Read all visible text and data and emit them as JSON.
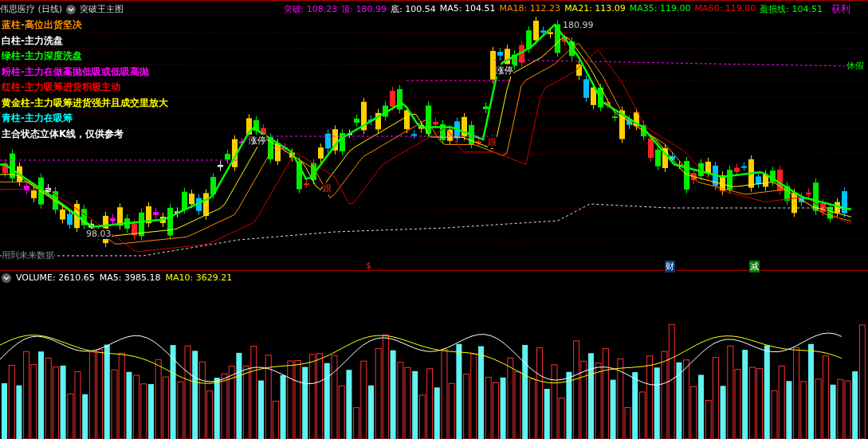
{
  "header": {
    "title": "伟思医疗 (日线)",
    "indicator": "突破王主图",
    "values": [
      {
        "label": "突破:",
        "value": "108.23",
        "color": "#ff00ff"
      },
      {
        "label": "顶:",
        "value": "180.99",
        "color": "#ff00ff"
      },
      {
        "label": "底:",
        "value": "100.54",
        "color": "#ffffff"
      },
      {
        "label": "MA5:",
        "value": "104.51",
        "color": "#ffffff"
      },
      {
        "label": "MA18:",
        "value": "112.23",
        "color": "#ff8c00"
      },
      {
        "label": "MA21:",
        "value": "113.09",
        "color": "#ffff00"
      },
      {
        "label": "MA35:",
        "value": "119.00",
        "color": "#00ff00"
      },
      {
        "label": "MA60:",
        "value": "119.00",
        "color": "#ff0000"
      },
      {
        "label": "盈损线:",
        "value": "104.51",
        "color": "#00ff00"
      }
    ],
    "action": "获利"
  },
  "legend": [
    {
      "text": "蓝柱-高位出货坚决",
      "color": "#ff8c00"
    },
    {
      "text": "白柱-主力洗盘",
      "color": "#ffffff"
    },
    {
      "text": "绿柱-主力深度洗盘",
      "color": "#00ff00"
    },
    {
      "text": "粉柱-主力在做高抛低吸或低吸高抛",
      "color": "#ff00ff"
    },
    {
      "text": "红柱-主力吸筹进货积极主动",
      "color": "#ff0000"
    },
    {
      "text": "黄金柱-主力吸筹进货强并且成交里放大",
      "color": "#ffff00"
    },
    {
      "text": "青柱-主力在吸筹",
      "color": "#00ffff"
    },
    {
      "text": "主合状态立体K线，仅供参考",
      "color": "#ffffff"
    }
  ],
  "chart_labels": [
    {
      "text": "180.99",
      "kind": "price"
    },
    {
      "text": "98.03",
      "kind": "price"
    },
    {
      "text": "涨停",
      "kind": "tag"
    },
    {
      "text": "涨停",
      "kind": "tag"
    },
    {
      "text": "跟",
      "kind": "signal"
    },
    {
      "text": "跟",
      "kind": "signal"
    },
    {
      "text": "休假",
      "kind": "note"
    },
    {
      "text": "用到未来数据",
      "kind": "warning"
    }
  ],
  "markers": [
    {
      "text": "$",
      "kind": "dollar"
    },
    {
      "text": "财",
      "kind": "finance"
    },
    {
      "text": "减",
      "kind": "reduce"
    }
  ],
  "volume": {
    "title": "VOLUME:",
    "value": "2610.65",
    "indicators": [
      {
        "label": "MA5:",
        "value": "3985.18",
        "color": "#ffffff"
      },
      {
        "label": "MA10:",
        "value": "3629.21",
        "color": "#ffff00"
      }
    ]
  }
}
